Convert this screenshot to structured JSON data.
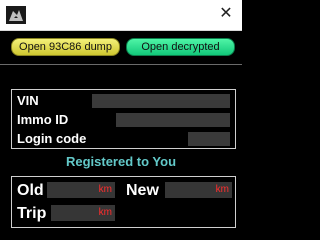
{
  "window": {
    "close_glyph": "✕",
    "icon": "app-logo-icon"
  },
  "toolbar": {
    "open_dump_label": "Open 93C86 dump",
    "open_decrypted_label": "Open decrypted",
    "open_dump_color": "#e6df55",
    "open_decrypted_color": "#2fe391"
  },
  "info": {
    "vin_label": "VIN",
    "immo_id_label": "Immo ID",
    "login_code_label": "Login code",
    "vin_value": "",
    "immo_id_value": "",
    "login_code_value": ""
  },
  "status": {
    "registered_text": "Registered to You",
    "color": "#63c9c9"
  },
  "odometer": {
    "old_label": "Old",
    "new_label": "New",
    "trip_label": "Trip",
    "unit": "km",
    "old_value": "",
    "new_value": "",
    "trip_value": "",
    "unit_color": "#ff2d2d"
  }
}
